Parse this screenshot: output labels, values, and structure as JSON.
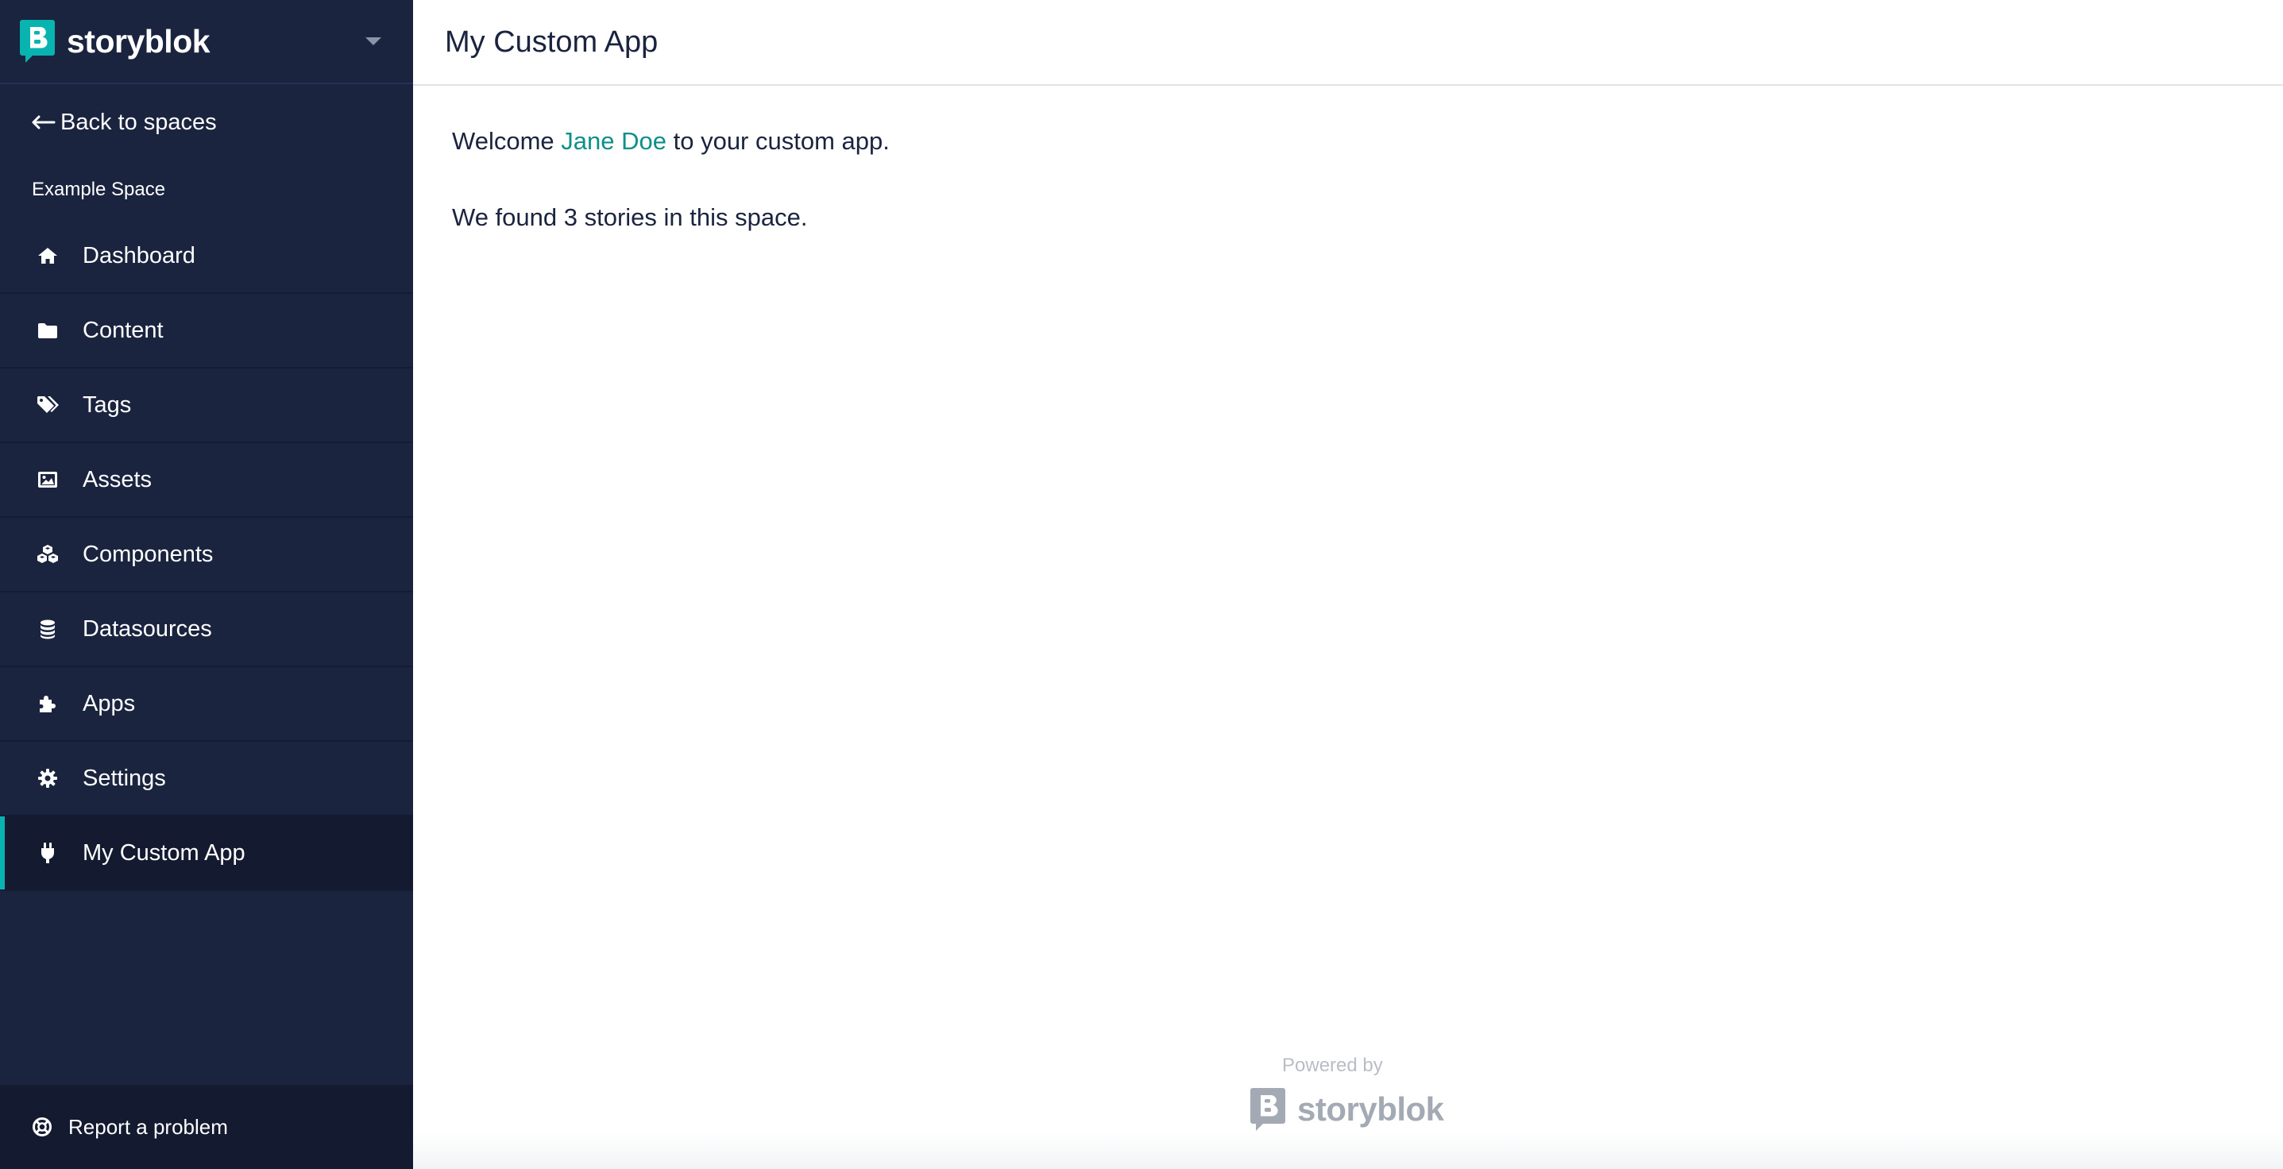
{
  "brand": {
    "name": "storyblok",
    "accent_color": "#09b3af",
    "logo_icon": "storyblok-logo-icon",
    "menu_icon": "chevron-down-icon"
  },
  "sidebar": {
    "background_color": "#1b243f",
    "back_link": {
      "label": "Back to spaces",
      "icon": "arrow-left-icon"
    },
    "space_name": "Example Space",
    "items": [
      {
        "label": "Dashboard",
        "icon": "home-icon",
        "active": false
      },
      {
        "label": "Content",
        "icon": "folder-icon",
        "active": false
      },
      {
        "label": "Tags",
        "icon": "tags-icon",
        "active": false
      },
      {
        "label": "Assets",
        "icon": "image-icon",
        "active": false
      },
      {
        "label": "Components",
        "icon": "cubes-icon",
        "active": false
      },
      {
        "label": "Datasources",
        "icon": "database-icon",
        "active": false
      },
      {
        "label": "Apps",
        "icon": "puzzle-icon",
        "active": false
      },
      {
        "label": "Settings",
        "icon": "gear-icon",
        "active": false
      },
      {
        "label": "My Custom App",
        "icon": "plug-icon",
        "active": true
      }
    ],
    "footer": {
      "label": "Report a problem",
      "icon": "lifebuoy-icon"
    }
  },
  "main": {
    "title": "My Custom App",
    "welcome": {
      "prefix": "Welcome",
      "user_name": "Jane Doe",
      "suffix": "to your custom app."
    },
    "stories_message": "We found 3 stories in this space.",
    "link_color": "#0e8f8a"
  },
  "footer": {
    "powered_by": "Powered by",
    "brand_name": "storyblok"
  }
}
